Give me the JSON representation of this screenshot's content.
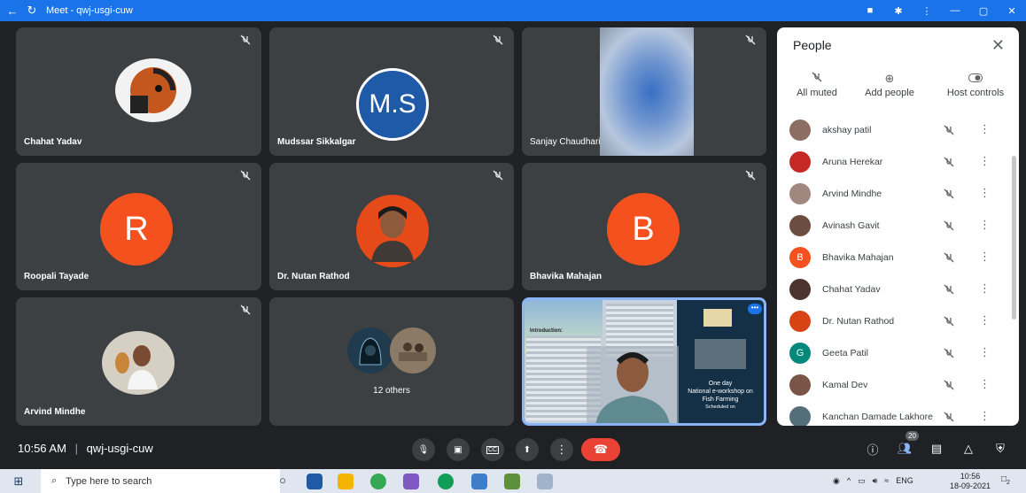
{
  "window": {
    "title": "Meet - qwj-usgi-cuw"
  },
  "tiles": [
    {
      "name": "Chahat Yadav"
    },
    {
      "name": "Mudssar Sikkalgar",
      "initials": "M.S"
    },
    {
      "name": "Sanjay Chaudhari"
    },
    {
      "name": "Roopali Tayade",
      "initials": "R"
    },
    {
      "name": "Dr. Nutan Rathod"
    },
    {
      "name": "Bhavika Mahajan",
      "initials": "B"
    },
    {
      "name": "Arvind Mindhe"
    },
    {
      "name": "12 others"
    },
    {
      "name": ""
    }
  ],
  "poster": {
    "line1": "One day",
    "line2": "National e-workshop on",
    "line3": "Fish Farming",
    "line4": "Scheduled on",
    "intro": "Introduction:"
  },
  "people": {
    "title": "People",
    "actions": [
      "All muted",
      "Add people",
      "Host controls"
    ],
    "list": [
      {
        "name": "akshay patil",
        "color": "#8d6e63",
        "initial": ""
      },
      {
        "name": "Aruna Herekar",
        "color": "#c62828",
        "initial": ""
      },
      {
        "name": "Arvind Mindhe",
        "color": "#a1887f",
        "initial": ""
      },
      {
        "name": "Avinash Gavit",
        "color": "#6d4c41",
        "initial": ""
      },
      {
        "name": "Bhavika Mahajan",
        "color": "#f4511e",
        "initial": "B"
      },
      {
        "name": "Chahat Yadav",
        "color": "#4e342e",
        "initial": ""
      },
      {
        "name": "Dr. Nutan Rathod",
        "color": "#d84315",
        "initial": ""
      },
      {
        "name": "Geeta Patil",
        "color": "#00897b",
        "initial": "G"
      },
      {
        "name": "Kamal Dev",
        "color": "#795548",
        "initial": ""
      },
      {
        "name": "Kanchan Damade Lakhore",
        "color": "#546e7a",
        "initial": ""
      }
    ]
  },
  "bottombar": {
    "time": "10:56 AM",
    "separator": "|",
    "meeting_code": "qwj-usgi-cuw",
    "participants_count": "20"
  },
  "taskbar": {
    "search_placeholder": "Type here to search",
    "lang": "ENG",
    "time": "10:56",
    "date": "18-09-2021",
    "notification_count": "2"
  },
  "colors": {
    "background": "#202124",
    "tile": "#3c4043",
    "accent": "#1a73e8",
    "hangup": "#ea4335",
    "avatar_ms": "#1e5aa8",
    "avatar_orange": "#f4511e"
  }
}
